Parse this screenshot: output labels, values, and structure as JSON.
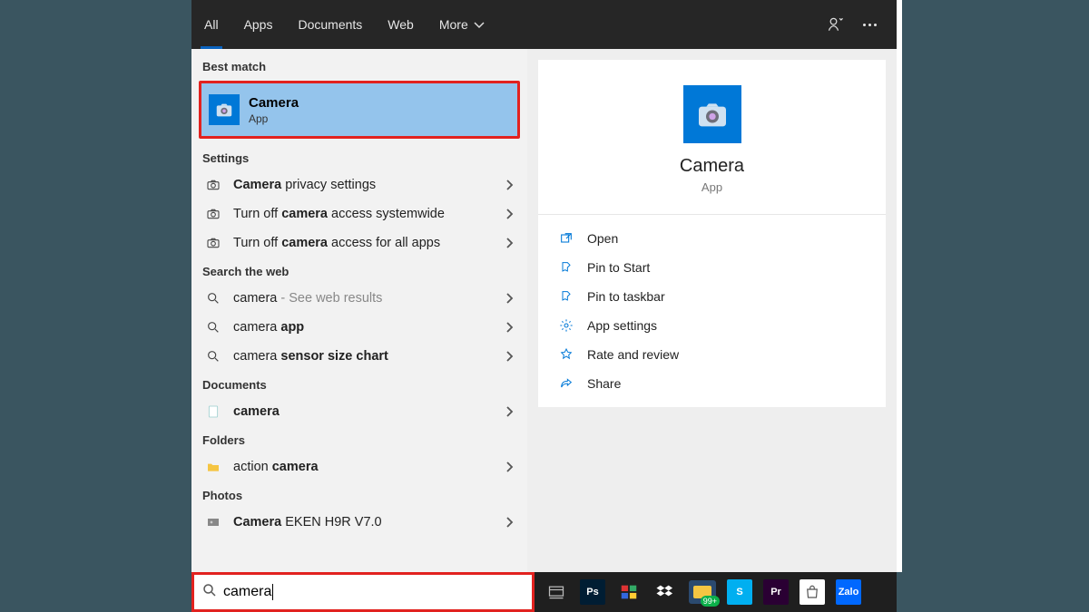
{
  "topbar": {
    "tabs": [
      "All",
      "Apps",
      "Documents",
      "Web",
      "More"
    ]
  },
  "left": {
    "sections": {
      "best_match": "Best match",
      "settings": "Settings",
      "search_web": "Search the web",
      "documents": "Documents",
      "folders": "Folders",
      "photos": "Photos"
    },
    "best_match_item": {
      "title": "Camera",
      "subtitle": "App"
    },
    "settings_items": [
      {
        "prefix_bold": "Camera",
        "suffix": " privacy settings"
      },
      {
        "prefix": "Turn off ",
        "bold": "camera",
        "suffix": " access systemwide"
      },
      {
        "prefix": "Turn off ",
        "bold": "camera",
        "suffix": " access for all apps"
      }
    ],
    "web_items": [
      {
        "text": "camera",
        "suffix": " - See web results"
      },
      {
        "text": "camera ",
        "bold": "app"
      },
      {
        "text": "camera ",
        "bold": "sensor size chart"
      }
    ],
    "doc_item": {
      "bold": "camera"
    },
    "folder_item": {
      "prefix": "action ",
      "bold": "camera"
    },
    "photo_item": {
      "bold": "Camera",
      "suffix": " EKEN H9R V7.0"
    }
  },
  "rightpane": {
    "title": "Camera",
    "subtitle": "App",
    "actions": [
      "Open",
      "Pin to Start",
      "Pin to taskbar",
      "App settings",
      "Rate and review",
      "Share"
    ]
  },
  "search": {
    "value": "camera"
  },
  "taskbar": {
    "ps": "Ps",
    "pr": "Pr",
    "skype": "S",
    "zalo": "Zalo",
    "badge": "99+"
  }
}
